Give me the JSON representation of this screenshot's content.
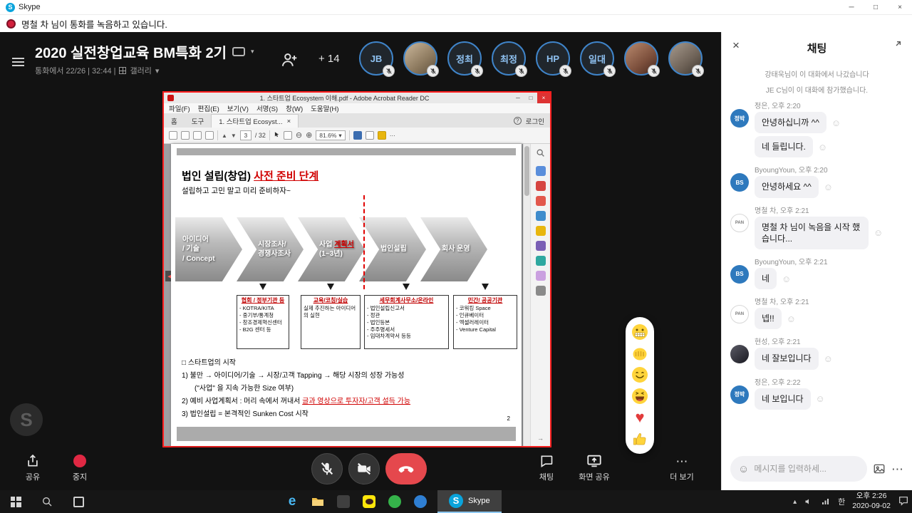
{
  "glyphs": {
    "s": "S",
    "minimize": "─",
    "maximize": "□",
    "close": "×",
    "caret_down": "▾",
    "up": "▲",
    "down": "▼",
    "back": "◀",
    "zoom_out": "⊖",
    "zoom_in": "⊕",
    "ellipsis": "⋯",
    "smiley": "☺",
    "heart": "♥",
    "help": "?",
    "caret_up": "▴",
    "collapse": "→"
  },
  "titlebar": {
    "app": "Skype"
  },
  "banner": {
    "text": "명철 차 님이 통화를 녹음하고 있습니다."
  },
  "call": {
    "title": "2020 실전창업교육 BM특화 2기",
    "meta": "통화에서 22/26 | 32:44 |",
    "gallery": "갤러리",
    "more_count": "+ 14",
    "watermark": "S",
    "participants": [
      "JB",
      "",
      "정최",
      "최정",
      "HP",
      "일대",
      "",
      ""
    ]
  },
  "controls": {
    "share": "공유",
    "stop": "중지",
    "chat": "채팅",
    "screen": "화면 공유",
    "more": "더 보기"
  },
  "reactions": [
    "grimace-emoji",
    "fist-emoji",
    "smile-emoji",
    "laugh-emoji",
    "heart-emoji",
    "thumbsup-emoji"
  ],
  "pdf": {
    "title": "1. 스타트업 Ecosystem 이해.pdf - Adobe Acrobat Reader DC",
    "menus": [
      "파일(F)",
      "편집(E)",
      "보기(V)",
      "서명(S)",
      "창(W)",
      "도움말(H)"
    ],
    "tabs": {
      "home": "홈",
      "tools": "도구",
      "doc": "1. 스타트업 Ecosyst...",
      "login": "로그인"
    },
    "toolbar": {
      "page": "3",
      "page_total": "/ 32",
      "zoom": "81.6%"
    },
    "slide": {
      "title_black": "법인 설립(창업) ",
      "title_red": "사전 준비 단계",
      "subtitle": "설립하고 고민 말고 미리 준비하자~",
      "arrow1_l1": "아이디어",
      "arrow1_l2": "/ 기술",
      "arrow1_l3": "/ Concept",
      "arrow2_l1": "시장조사/",
      "arrow2_l2": "경쟁사조사",
      "arrow3_pre": "사업 ",
      "arrow3_red": "계획서",
      "arrow3_l2": "(1~3년)",
      "arrow4": "법인설립",
      "arrow5": "회사 운영",
      "box1_title": "협회 / 정부기관 등",
      "box1_items": [
        "KOTRA/KITA",
        "중기부/통계청",
        "창조경제혁신센터",
        "B2G 센터 등"
      ],
      "box2_title": "교육/코칭/실습",
      "box2_body": "실제 추진하는 아이디어의 실현",
      "box3_title": "세무회계사무소/온라인",
      "box3_items": [
        "법인설립신고서",
        "정관",
        "법인등본",
        "주주명세서",
        "임대차계약서 등등"
      ],
      "box4_title": "민간/ 공공기관",
      "box4_items": [
        "코워킹 Space",
        "인큐베이터",
        "엑셀러레이터",
        "Venture Capital"
      ],
      "list_title": "□ 스타트업의 시작",
      "line1": "1) 불만 → 아이디어/기술 → 시장/고객 Tapping → 해당 시장의 성장 가능성",
      "line1b": "(\"사업\" 을 지속 가능한 Size 여부)",
      "line2_pre": "2) 예비 사업계획서 : 머리 속에서 꺼내서 ",
      "line2_red": "글과 영상으로 투자자/고객 설득 가능",
      "line3": "3) 법인설립 = 본격적인 Sunken Cost 시작",
      "page_no": "2"
    }
  },
  "chat": {
    "title": "채팅",
    "sys1": "강태욱님이 이 대화에서 나갔습니다",
    "sys2": "JE C님이 이 대화에 참가했습니다.",
    "g1": {
      "avatar": "정박",
      "name": "정은, 오후 2:20",
      "m1": "안녕하십니까 ^^",
      "m2": "네 들립니다."
    },
    "g2": {
      "avatar": "BS",
      "name": "ByoungYoun, 오후 2:20",
      "m1": "안녕하세요 ^^"
    },
    "g3": {
      "avatar": "PAN",
      "name": "명철 차, 오후 2:21",
      "m1": "명철 차 님이 녹음을 시작 했습니다..."
    },
    "g4": {
      "avatar": "BS",
      "name": "ByoungYoun, 오후 2:21",
      "m1": "네"
    },
    "g5": {
      "avatar": "PAN",
      "name": "명철 차, 오후 2:21",
      "m1": "넵!!"
    },
    "g6": {
      "avatar": "",
      "name": "현성, 오후 2:21",
      "m1": "네 잘보입니다"
    },
    "g7": {
      "avatar": "정박",
      "name": "정은, 오후 2:22",
      "m1": "네 보입니다"
    },
    "placeholder": "메시지를 입력하세..."
  },
  "taskbar": {
    "edge_letter": "e",
    "skype": "Skype",
    "lang": "한",
    "time": "오후 2:26",
    "date": "2020-09-02"
  }
}
